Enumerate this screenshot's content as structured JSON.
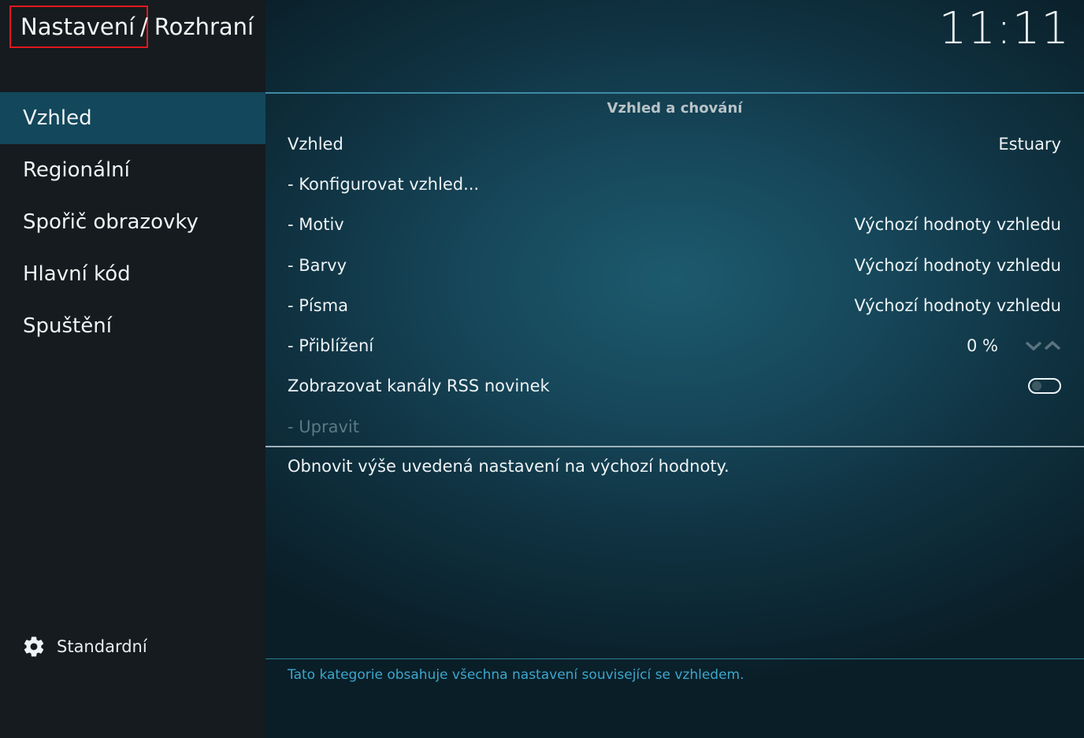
{
  "breadcrumb": {
    "section": "Nastavení",
    "separator": "/",
    "current": "Rozhraní"
  },
  "clock": "11:11",
  "sidebar": {
    "items": [
      {
        "label": "Vzhled",
        "active": true
      },
      {
        "label": "Regionální",
        "active": false
      },
      {
        "label": "Spořič obrazovky",
        "active": false
      },
      {
        "label": "Hlavní kód",
        "active": false
      },
      {
        "label": "Spuštění",
        "active": false
      }
    ],
    "level": {
      "icon": "gear-icon",
      "label": "Standardní"
    }
  },
  "main": {
    "section_title": "Vzhled a chování",
    "settings": [
      {
        "label": "Vzhled",
        "value": "Estuary"
      },
      {
        "label": "- Konfigurovat vzhled...",
        "value": ""
      },
      {
        "label": "- Motiv",
        "value": "Výchozí hodnoty vzhledu"
      },
      {
        "label": "- Barvy",
        "value": "Výchozí hodnoty vzhledu"
      },
      {
        "label": "- Písma",
        "value": "Výchozí hodnoty vzhledu"
      },
      {
        "label": "- Přiblížení",
        "value": "0 %"
      },
      {
        "label": "Zobrazovat kanály RSS novinek",
        "value": ""
      },
      {
        "label": "- Upravit",
        "value": ""
      }
    ],
    "rss_enabled": false,
    "description": "Obnovit výše uvedená nastavení na výchozí hodnoty.",
    "footer_info": "Tato kategorie obsahuje všechna nastavení související se vzhledem."
  },
  "colors": {
    "active_item": "#12475c",
    "highlight_border": "#e0181e",
    "info_text": "#3da6cc"
  }
}
